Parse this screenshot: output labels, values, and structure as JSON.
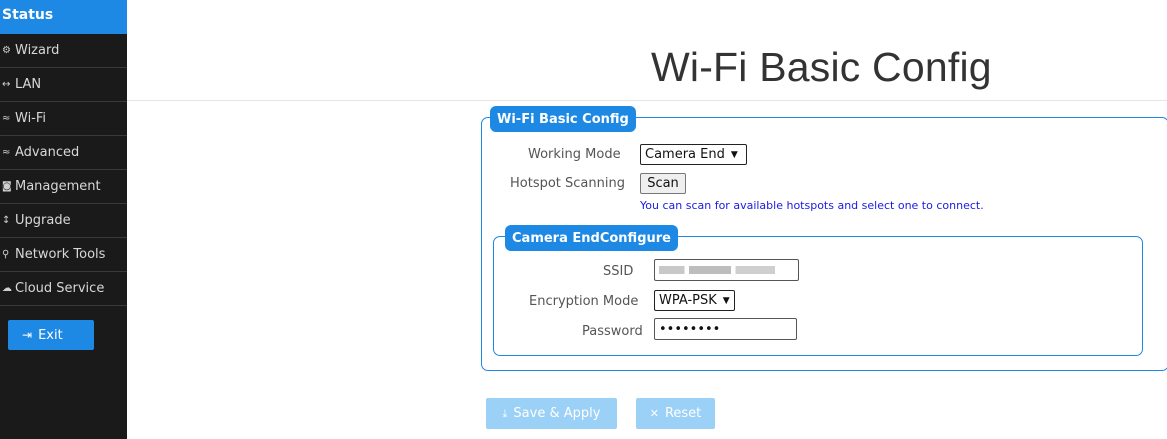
{
  "sidebar": {
    "status": "Status",
    "items": [
      {
        "label": "Wizard",
        "icon": "gear-icon",
        "glyph": "⚙"
      },
      {
        "label": "LAN",
        "icon": "arrows-icon",
        "glyph": "↔"
      },
      {
        "label": "Wi-Fi",
        "icon": "wifi-icon",
        "glyph": "≈"
      },
      {
        "label": "Advanced",
        "icon": "wifi-icon",
        "glyph": "≈"
      },
      {
        "label": "Management",
        "icon": "management-icon",
        "glyph": "◙"
      },
      {
        "label": "Upgrade",
        "icon": "upgrade-icon",
        "glyph": "↕"
      },
      {
        "label": "Network Tools",
        "icon": "search-icon",
        "glyph": "⚲"
      },
      {
        "label": "Cloud Service",
        "icon": "cloud-icon",
        "glyph": "☁"
      }
    ],
    "exit_label": "Exit"
  },
  "page": {
    "title": "Wi-Fi Basic Config"
  },
  "basic": {
    "legend": "Wi-Fi Basic Config",
    "working_mode_label": "Working Mode",
    "working_mode_value": "Camera End",
    "hotspot_label": "Hotspot Scanning",
    "scan_label": "Scan",
    "hint": "You can scan for available hotspots and select one to connect."
  },
  "camera": {
    "legend": "Camera EndConfigure",
    "ssid_label": "SSID",
    "encryption_label": "Encryption Mode",
    "encryption_value": "WPA-PSK",
    "password_label": "Password",
    "password_value": "••••••••"
  },
  "actions": {
    "save_label": "Save & Apply",
    "reset_label": "Reset"
  },
  "colors": {
    "accent": "#1e88e5",
    "sidebar_bg": "#1a1a1a",
    "button_disabled": "#9bd0f7",
    "hint_text": "#1a1ae6"
  }
}
